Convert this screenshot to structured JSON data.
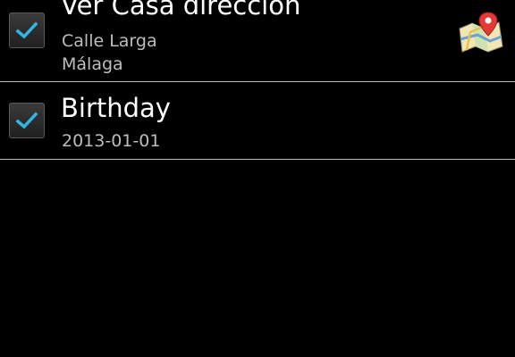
{
  "items": [
    {
      "title": "Ver Casa dirección",
      "line1": "Calle Larga",
      "line2": "Málaga",
      "checked": true,
      "icon": "map-icon"
    },
    {
      "title": "Birthday",
      "line1": "2013-01-01",
      "checked": true
    }
  ],
  "colors": {
    "background": "#000000",
    "check": "#33b5e5",
    "divider": "#bdbdbd",
    "secondary_text": "#bdbdbd"
  }
}
